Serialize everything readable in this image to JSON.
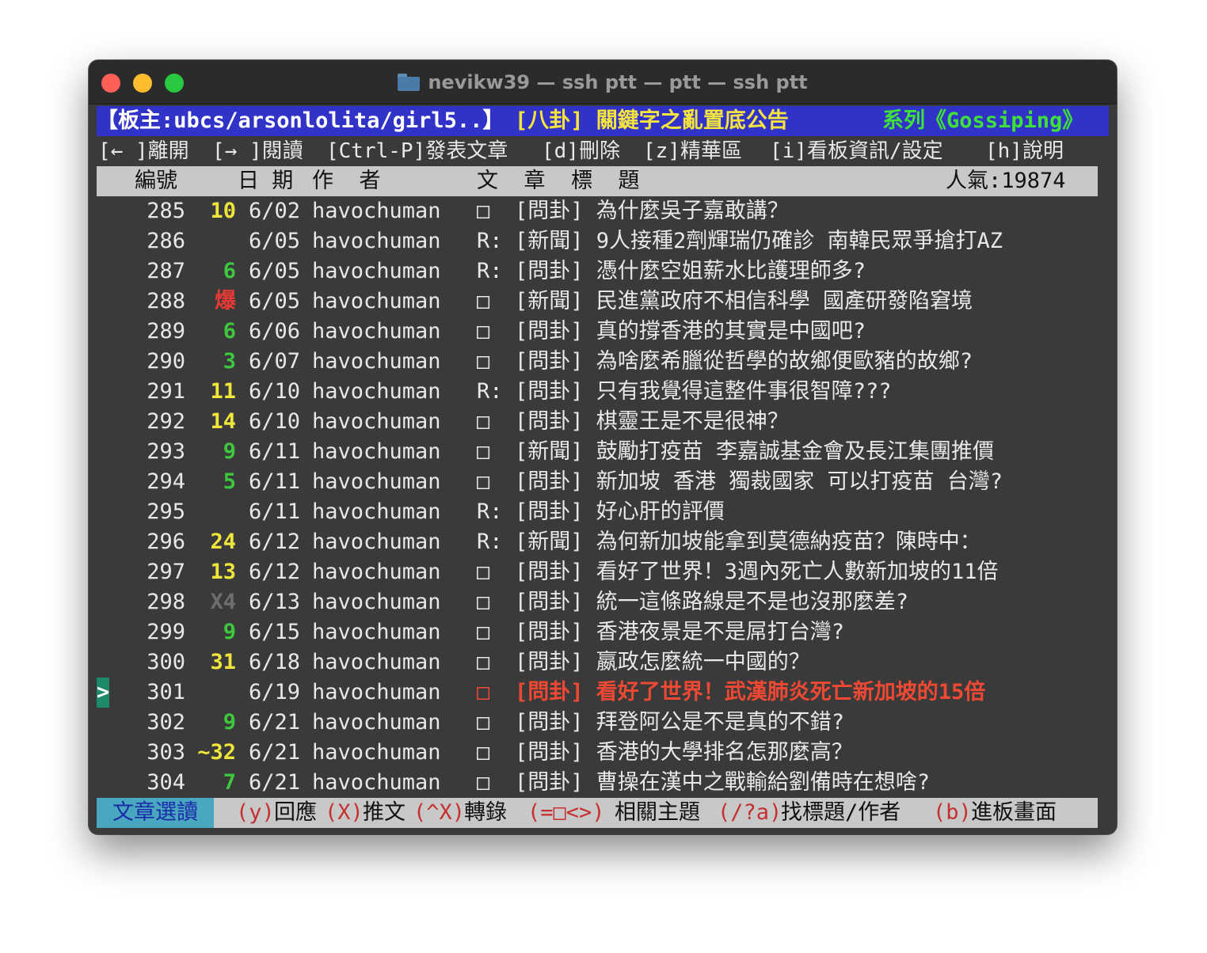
{
  "window": {
    "title": "nevikw39 — ssh ptt — ptt — ssh ptt",
    "icon": "folder-icon"
  },
  "header": {
    "left": "【板主:ubcs/arsonlolita/girl5..】",
    "board": "[八卦] 關鍵字之亂置底公告",
    "series": "系列《Gossiping》"
  },
  "menu": [
    "[← ]離開",
    "[→ ]閱讀",
    "[Ctrl-P]發表文章",
    "[d]刪除",
    "[z]精華區",
    "[i]看板資訊/設定",
    "[h]說明"
  ],
  "columns": {
    "num": "編號",
    "date": "日 期",
    "author": "作  者",
    "title": "文  章  標  題",
    "popularity": "人氣:19874"
  },
  "cursor": ">",
  "rows": [
    {
      "num": "285",
      "rec": "10",
      "rec_color": "yellow",
      "date": "6/02",
      "author": "havochuman",
      "mark": "□",
      "title": "[問卦] 為什麼吳子嘉敢講？"
    },
    {
      "num": "286",
      "rec": "",
      "rec_color": "",
      "date": "6/05",
      "author": "havochuman",
      "mark": "R:",
      "title": "[新聞] 9人接種2劑輝瑞仍確診 南韓民眾爭搶打AZ"
    },
    {
      "num": "287",
      "rec": "6",
      "rec_color": "green",
      "date": "6/05",
      "author": "havochuman",
      "mark": "R:",
      "title": "[問卦] 憑什麼空姐薪水比護理師多?"
    },
    {
      "num": "288",
      "rec": "爆",
      "rec_color": "red",
      "date": "6/05",
      "author": "havochuman",
      "mark": "□",
      "title": "[新聞] 民進黨政府不相信科學 國產研發陷窘境"
    },
    {
      "num": "289",
      "rec": "6",
      "rec_color": "green",
      "date": "6/06",
      "author": "havochuman",
      "mark": "□",
      "title": "[問卦] 真的撐香港的其實是中國吧?"
    },
    {
      "num": "290",
      "rec": "3",
      "rec_color": "green",
      "date": "6/07",
      "author": "havochuman",
      "mark": "□",
      "title": "[問卦] 為啥麼希臘從哲學的故鄉便歐豬的故鄉?"
    },
    {
      "num": "291",
      "rec": "11",
      "rec_color": "yellow",
      "date": "6/10",
      "author": "havochuman",
      "mark": "R:",
      "title": "[問卦] 只有我覺得這整件事很智障???"
    },
    {
      "num": "292",
      "rec": "14",
      "rec_color": "yellow",
      "date": "6/10",
      "author": "havochuman",
      "mark": "□",
      "title": "[問卦] 棋靈王是不是很神？"
    },
    {
      "num": "293",
      "rec": "9",
      "rec_color": "green",
      "date": "6/11",
      "author": "havochuman",
      "mark": "□",
      "title": "[新聞] 鼓勵打疫苗 李嘉誠基金會及長江集團推價"
    },
    {
      "num": "294",
      "rec": "5",
      "rec_color": "green",
      "date": "6/11",
      "author": "havochuman",
      "mark": "□",
      "title": "[問卦] 新加坡 香港 獨裁國家 可以打疫苗 台灣?"
    },
    {
      "num": "295",
      "rec": "",
      "rec_color": "",
      "date": "6/11",
      "author": "havochuman",
      "mark": "R:",
      "title": "[問卦] 好心肝的評價"
    },
    {
      "num": "296",
      "rec": "24",
      "rec_color": "yellow",
      "date": "6/12",
      "author": "havochuman",
      "mark": "R:",
      "title": "[新聞] 為何新加坡能拿到莫德納疫苗？陳時中："
    },
    {
      "num": "297",
      "rec": "13",
      "rec_color": "yellow",
      "date": "6/12",
      "author": "havochuman",
      "mark": "□",
      "title": "[問卦] 看好了世界！3週內死亡人數新加坡的11倍"
    },
    {
      "num": "298",
      "rec": "X4",
      "rec_color": "gray",
      "date": "6/13",
      "author": "havochuman",
      "mark": "□",
      "title": "[問卦] 統一這條路線是不是也沒那麼差?"
    },
    {
      "num": "299",
      "rec": "9",
      "rec_color": "green",
      "date": "6/15",
      "author": "havochuman",
      "mark": "□",
      "title": "[問卦] 香港夜景是不是屌打台灣?"
    },
    {
      "num": "300",
      "rec": "31",
      "rec_color": "yellow",
      "date": "6/18",
      "author": "havochuman",
      "mark": "□",
      "title": "[問卦] 嬴政怎麼統一中國的？"
    },
    {
      "num": "301",
      "rec": "",
      "rec_color": "",
      "date": "6/19",
      "author": "havochuman",
      "mark": "□",
      "title": "[問卦] 看好了世界！武漢肺炎死亡新加坡的15倍",
      "selected": true
    },
    {
      "num": "302",
      "rec": "9",
      "rec_color": "green",
      "date": "6/21",
      "author": "havochuman",
      "mark": "□",
      "title": "[問卦] 拜登阿公是不是真的不錯?"
    },
    {
      "num": "303",
      "rec": "~32",
      "rec_color": "yellow",
      "date": "6/21",
      "author": "havochuman",
      "mark": "□",
      "title": "[問卦] 香港的大學排名怎那麼高？"
    },
    {
      "num": "304",
      "rec": "7",
      "rec_color": "green",
      "date": "6/21",
      "author": "havochuman",
      "mark": "□",
      "title": "[問卦] 曹操在漢中之戰輸給劉備時在想啥?"
    }
  ],
  "footer": {
    "mode": "文章選讀",
    "items": [
      {
        "key": "(y)",
        "label": "回應"
      },
      {
        "key": "(X)",
        "label": "推文"
      },
      {
        "key": "(^X)",
        "label": "轉錄"
      },
      {
        "key": "(=□<>)",
        "label": "相關主題"
      },
      {
        "key": "(/?a)",
        "label": "找標題/作者"
      },
      {
        "key": "(b)",
        "label": "進板畫面"
      }
    ]
  },
  "colors": {
    "terminal_bg": "#3a3a3a",
    "header_bg": "#3132c8",
    "highlight_red": "#ef4934",
    "yellow": "#f0e53a",
    "green": "#3ec83e"
  }
}
